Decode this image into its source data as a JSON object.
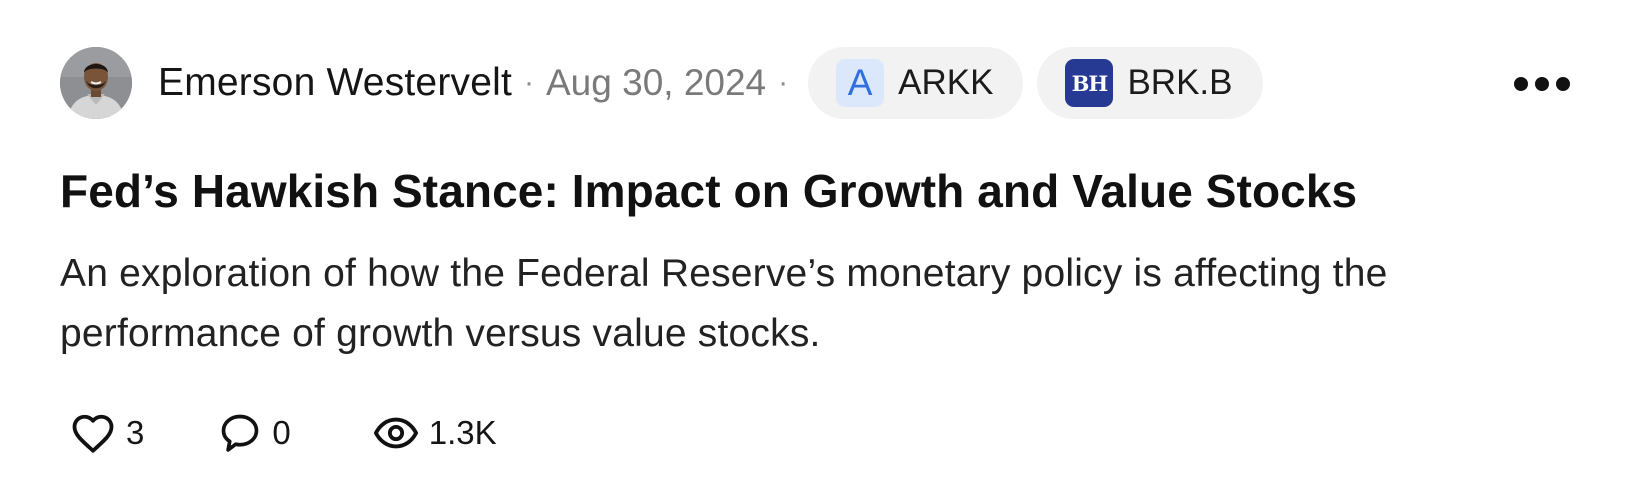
{
  "post": {
    "author": {
      "name": "Emerson Westervelt",
      "avatar": "profile-photo"
    },
    "separator": "·",
    "date": "Aug 30, 2024",
    "tickers": [
      {
        "symbol": "ARKK",
        "logo_text": "A",
        "logo_bg": "#dbe8fb",
        "logo_color": "#2f6fe0"
      },
      {
        "symbol": "BRK.B",
        "logo_text": "BH",
        "logo_bg": "#263a94",
        "logo_color": "#ffffff"
      }
    ],
    "more_icon": "more-horizontal-icon",
    "title": "Fed’s Hawkish Stance: Impact on Growth and Value Stocks",
    "description": "An exploration of how the Federal Reserve’s monetary policy is affecting the performance of growth versus value stocks.",
    "stats": {
      "likes": "3",
      "comments": "0",
      "views": "1.3K"
    }
  },
  "colors": {
    "chip_bg": "#f2f2f2",
    "muted_text": "#7a7a7a",
    "text": "#111111"
  }
}
